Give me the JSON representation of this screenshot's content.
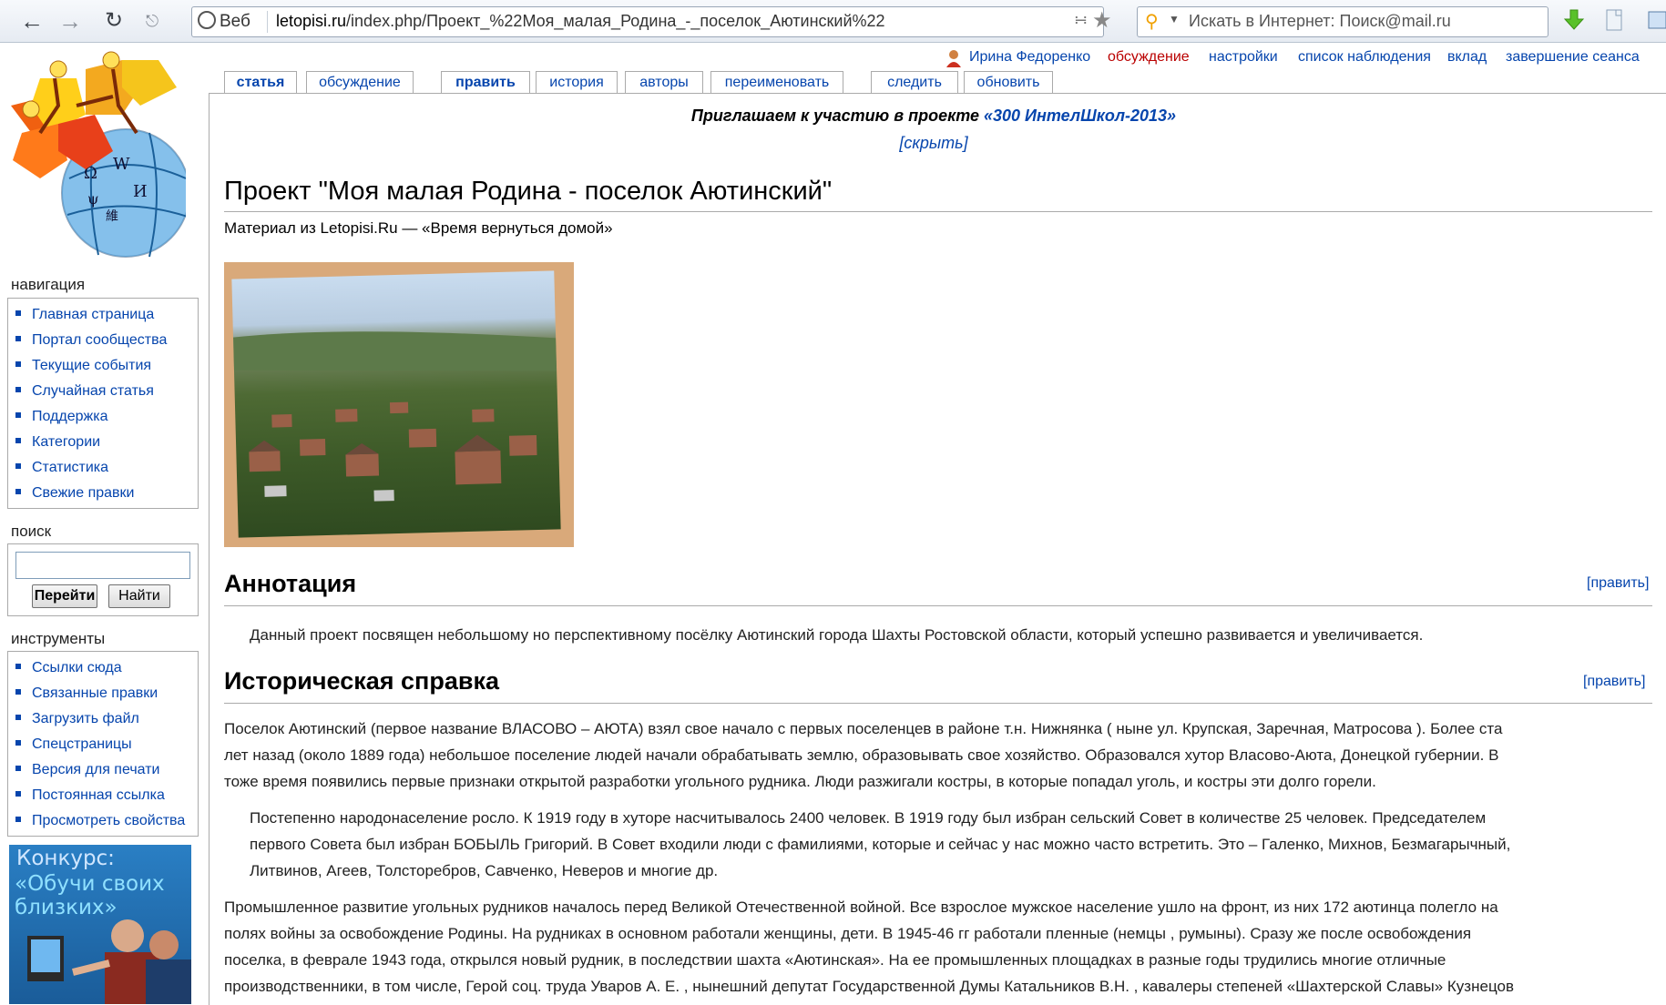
{
  "browser": {
    "site_label": "Веб",
    "url_domain": "letopisi.ru",
    "url_path": "/index.php/Проект_%22Моя_малая_Родина_-_поселок_Аютинский%22",
    "search_placeholder": "Искать в Интернет: Поиск@mail.ru"
  },
  "userbar": {
    "username": "Ирина Федоренко",
    "items": [
      "обсуждение",
      "настройки",
      "список наблюдения",
      "вклад",
      "завершение сеанса"
    ]
  },
  "tabs": [
    "статья",
    "обсуждение",
    "править",
    "история",
    "авторы",
    "переименовать",
    "следить",
    "обновить"
  ],
  "banner": {
    "text": "Приглашаем к участию в проекте ",
    "link": "«300 ИнтелШкол-2013»",
    "hide": "[скрыть]"
  },
  "sidebar": {
    "nav_title": "навигация",
    "nav_items": [
      "Главная страница",
      "Портал сообщества",
      "Текущие события",
      "Случайная статья",
      "Поддержка",
      "Категории",
      "Статистика",
      "Свежие правки"
    ],
    "search_title": "поиск",
    "go_button": "Перейти",
    "find_button": "Найти",
    "tools_title": "инструменты",
    "tools_items": [
      "Ссылки сюда",
      "Связанные правки",
      "Загрузить файл",
      "Спецстраницы",
      "Версия для печати",
      "Постоянная ссылка",
      "Просмотреть свойства"
    ],
    "promo_line1": "Конкурс:",
    "promo_line2": "«Обучи своих",
    "promo_line3": "близких»"
  },
  "article": {
    "title": "Проект \"Моя малая Родина - поселок Аютинский\"",
    "subtitle": "Материал из Letopisi.Ru — «Время вернуться домой»",
    "edit_label": "[править]",
    "section1": "Аннотация",
    "section1_text": "Данный проект посвящен небольшому но перспективному посёлку Аютинский города Шахты Ростовской области, который успешно развивается и увеличивается.",
    "section2": "Историческая справка",
    "p1_l1": "Поселок Аютинский (первое название ВЛАСОВО – АЮТА) взял свое начало с первых поселенцев в районе т.н. Нижнянка ( ныне ул. Крупская, Заречная, Матросова ). Более ста",
    "p1_l2": "лет назад (около 1889 года) небольшое поселение людей начали обрабатывать землю, образовывать свое хозяйство. Образовался хутор Власово-Аюта, Донецкой губернии. В",
    "p1_l3": "тоже время появились первые признаки открытой разработки угольного рудника. Люди разжигали костры, в которые попадал уголь, и костры эти долго горели.",
    "p2_l1": "Постепенно народонаселение росло. К 1919 году в хуторе насчитывалось 2400 человек. В 1919 году был избран сельский Совет в количестве 25 человек. Председателем",
    "p2_l2": "первого Совета был избран БОБЫЛЬ Григорий. В Совет входили люди с фамилиями, которые и сейчас у нас можно часто встретить. Это – Галенко, Михнов, Безмагарычный,",
    "p2_l3": "Литвинов, Агеев, Толсторебров, Савченко, Неверов и многие др.",
    "p3_l1": "Промышленное развитие угольных рудников началось перед Великой Отечественной войной. Все взрослое мужское население ушло на фронт, из них 172 аютинца полегло на",
    "p3_l2": "полях войны за освобождение Родины. На рудниках в основном работали женщины, дети. В 1945-46 гг работали пленные (немцы , румыны). Сразу же после освобождения",
    "p3_l3": "поселка, в феврале 1943 года, открылся новый рудник, в последствии шахта «Аютинская». На ее промышленных площадках в разные годы трудились многие отличные",
    "p3_l4": "производственники, в том числе, Герой соц. труда Уваров А. Е. , нынешний депутат Государственной Думы Катальников В.Н. , кавалеры степеней «Шахтерской Славы» Кузнецов"
  }
}
